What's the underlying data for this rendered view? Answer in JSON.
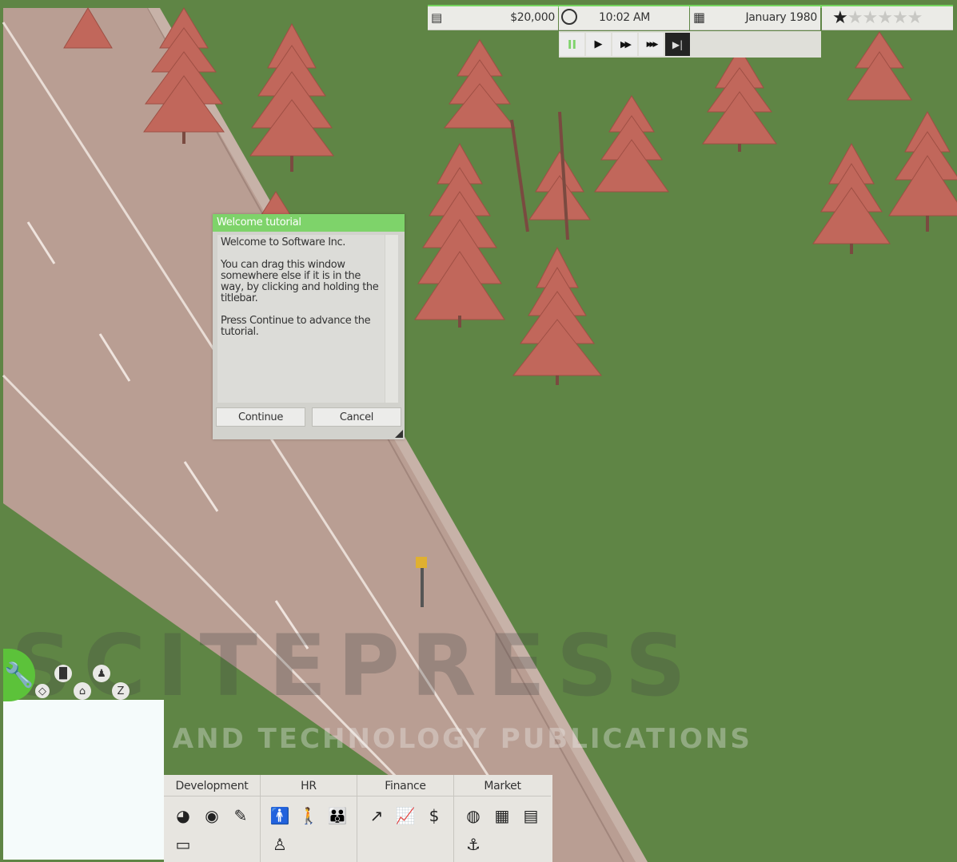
{
  "hud": {
    "money": "$20,000",
    "time": "10:02 AM",
    "date": "January 1980",
    "rating_stars": 1,
    "max_stars": 6
  },
  "speed_controls": {
    "pause": "II",
    "play": "▶",
    "fast": "▶▶",
    "faster": "▶▶▶",
    "skip": "▶|"
  },
  "tutorial": {
    "title": "Welcome tutorial",
    "line1": "Welcome to Software Inc.",
    "line2": "You can drag this window somewhere else if it is in the way, by clicking and holding the titlebar.",
    "line3": "Press Continue to advance the tutorial.",
    "continue_label": "Continue",
    "cancel_label": "Cancel"
  },
  "menu": {
    "development": "Development",
    "hr": "HR",
    "finance": "Finance",
    "market": "Market"
  },
  "watermark": {
    "line1": "SCITEPRESS",
    "line2": "SCIENCE AND TECHNOLOGY PUBLICATIONS"
  },
  "colors": {
    "grass": "#5f8545",
    "road": "#b89d92",
    "tree": "#c0665a",
    "accent_green": "#7ed36a"
  }
}
